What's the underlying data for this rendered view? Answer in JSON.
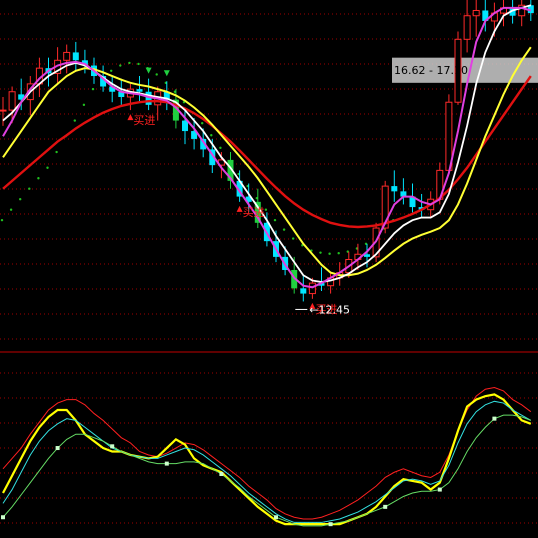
{
  "chart_data": [
    {
      "type": "candlestick",
      "panel": "price",
      "ylim": [
        11.6,
        18.2
      ],
      "colors": {
        "up": "#ff2a2a",
        "down": "#00e5ff",
        "down_big": "#20d040",
        "ma_white": "#ffffff",
        "ma_magenta": "#e040e0",
        "ma_yellow": "#ffff33",
        "ma_red": "#e01010",
        "dots": "#20c020",
        "signal": "#ff2020",
        "arrow": "#20d040",
        "band": "#cccccc"
      },
      "candles": [
        [
          0,
          16.1,
          16.35,
          15.8,
          16.1
        ],
        [
          1,
          16.1,
          16.55,
          15.85,
          16.45
        ],
        [
          2,
          16.4,
          16.7,
          16.1,
          16.3
        ],
        [
          3,
          16.3,
          16.75,
          16.0,
          16.6
        ],
        [
          4,
          16.6,
          17.1,
          16.35,
          16.9
        ],
        [
          5,
          16.9,
          17.1,
          16.55,
          16.8
        ],
        [
          6,
          16.8,
          17.3,
          16.6,
          17.05
        ],
        [
          7,
          17.05,
          17.35,
          16.8,
          17.2
        ],
        [
          8,
          17.2,
          17.4,
          16.85,
          17.05
        ],
        [
          9,
          17.05,
          17.25,
          16.8,
          16.95
        ],
        [
          10,
          16.95,
          17.1,
          16.6,
          16.75
        ],
        [
          11,
          16.75,
          16.95,
          16.45,
          16.55
        ],
        [
          12,
          16.55,
          16.75,
          16.25,
          16.45
        ],
        [
          13,
          16.45,
          16.7,
          16.2,
          16.35
        ],
        [
          14,
          16.35,
          16.6,
          16.1,
          16.5
        ],
        [
          15,
          16.5,
          16.75,
          16.25,
          16.45
        ],
        [
          16,
          16.45,
          16.7,
          16.1,
          16.2
        ],
        [
          17,
          16.2,
          16.55,
          15.9,
          16.45
        ],
        [
          18,
          16.45,
          16.65,
          16.1,
          16.3
        ],
        [
          19,
          16.3,
          16.5,
          15.75,
          15.9
        ],
        [
          20,
          15.9,
          16.1,
          15.45,
          15.7
        ],
        [
          21,
          15.7,
          15.95,
          15.35,
          15.55
        ],
        [
          22,
          15.55,
          15.75,
          15.2,
          15.35
        ],
        [
          23,
          15.35,
          15.55,
          14.9,
          15.05
        ],
        [
          24,
          15.05,
          15.3,
          14.8,
          15.15
        ],
        [
          25,
          15.15,
          15.3,
          14.6,
          14.75
        ],
        [
          26,
          14.75,
          14.95,
          14.35,
          14.45
        ],
        [
          27,
          14.45,
          14.7,
          14.15,
          14.35
        ],
        [
          28,
          14.35,
          14.6,
          13.85,
          13.95
        ],
        [
          29,
          13.95,
          14.15,
          13.5,
          13.6
        ],
        [
          30,
          13.6,
          13.8,
          13.2,
          13.3
        ],
        [
          31,
          13.3,
          13.5,
          12.95,
          13.05
        ],
        [
          32,
          13.05,
          13.3,
          12.6,
          12.7
        ],
        [
          33,
          12.7,
          12.95,
          12.45,
          12.6
        ],
        [
          34,
          12.6,
          12.9,
          12.5,
          12.8
        ],
        [
          35,
          12.8,
          13.1,
          12.65,
          12.75
        ],
        [
          36,
          12.75,
          13.0,
          12.6,
          12.9
        ],
        [
          37,
          12.9,
          13.2,
          12.75,
          13.0
        ],
        [
          38,
          13.0,
          13.4,
          12.9,
          13.25
        ],
        [
          39,
          13.25,
          13.55,
          13.05,
          13.35
        ],
        [
          40,
          13.35,
          13.55,
          13.1,
          13.3
        ],
        [
          41,
          13.3,
          13.95,
          13.2,
          13.85
        ],
        [
          42,
          13.85,
          14.75,
          13.75,
          14.65
        ],
        [
          43,
          14.65,
          14.95,
          14.35,
          14.55
        ],
        [
          44,
          14.55,
          14.8,
          14.3,
          14.45
        ],
        [
          45,
          14.45,
          14.7,
          14.15,
          14.25
        ],
        [
          46,
          14.25,
          14.5,
          14.05,
          14.2
        ],
        [
          47,
          14.2,
          14.55,
          14.05,
          14.4
        ],
        [
          48,
          14.4,
          15.1,
          14.3,
          14.95
        ],
        [
          49,
          14.95,
          16.4,
          14.9,
          16.25
        ],
        [
          50,
          16.25,
          17.6,
          16.2,
          17.45
        ],
        [
          51,
          17.45,
          18.2,
          17.2,
          17.9
        ],
        [
          52,
          17.9,
          18.2,
          17.5,
          18.0
        ],
        [
          53,
          18.0,
          18.2,
          17.6,
          17.8
        ],
        [
          54,
          17.8,
          18.15,
          17.5,
          17.95
        ],
        [
          55,
          17.95,
          18.2,
          17.7,
          18.05
        ],
        [
          56,
          18.05,
          18.2,
          17.75,
          17.9
        ],
        [
          57,
          17.9,
          18.2,
          17.7,
          18.1
        ],
        [
          58,
          18.1,
          18.2,
          17.8,
          17.95
        ]
      ],
      "ma_white": [
        15.9,
        16.05,
        16.25,
        16.45,
        16.6,
        16.75,
        16.85,
        16.95,
        17.0,
        16.95,
        16.85,
        16.72,
        16.6,
        16.5,
        16.45,
        16.42,
        16.38,
        16.35,
        16.32,
        16.25,
        16.1,
        15.9,
        15.7,
        15.45,
        15.2,
        15.0,
        14.75,
        14.5,
        14.25,
        14.0,
        13.7,
        13.45,
        13.2,
        12.95,
        12.85,
        12.82,
        12.85,
        12.9,
        12.98,
        13.1,
        13.2,
        13.35,
        13.55,
        13.75,
        13.9,
        14.0,
        14.05,
        14.05,
        14.15,
        14.5,
        15.1,
        15.8,
        16.6,
        17.2,
        17.6,
        17.9,
        18.0,
        18.05,
        18.1
      ],
      "ma_magenta": [
        15.6,
        15.9,
        16.25,
        16.5,
        16.7,
        16.85,
        16.95,
        17.0,
        17.02,
        16.98,
        16.85,
        16.7,
        16.55,
        16.45,
        16.42,
        16.4,
        16.35,
        16.32,
        16.28,
        16.15,
        15.95,
        15.75,
        15.5,
        15.25,
        15.0,
        14.8,
        14.55,
        14.3,
        14.05,
        13.75,
        13.45,
        13.15,
        12.9,
        12.75,
        12.72,
        12.8,
        12.9,
        13.0,
        13.12,
        13.25,
        13.4,
        13.6,
        13.95,
        14.3,
        14.45,
        14.45,
        14.35,
        14.3,
        14.4,
        14.9,
        15.7,
        16.6,
        17.4,
        17.8,
        17.95,
        18.05,
        18.05,
        18.05,
        18.0
      ],
      "ma_yellow": [
        15.2,
        15.45,
        15.7,
        15.95,
        16.2,
        16.45,
        16.6,
        16.75,
        16.85,
        16.9,
        16.88,
        16.82,
        16.75,
        16.68,
        16.62,
        16.58,
        16.55,
        16.5,
        16.45,
        16.38,
        16.28,
        16.15,
        16.0,
        15.82,
        15.62,
        15.42,
        15.22,
        15.02,
        14.8,
        14.55,
        14.3,
        14.05,
        13.8,
        13.55,
        13.35,
        13.15,
        13.0,
        12.95,
        12.95,
        12.98,
        13.05,
        13.15,
        13.28,
        13.42,
        13.55,
        13.65,
        13.72,
        13.78,
        13.85,
        14.0,
        14.3,
        14.7,
        15.15,
        15.6,
        16.0,
        16.4,
        16.75,
        17.05,
        17.3
      ],
      "ma_red": [
        14.6,
        14.75,
        14.9,
        15.05,
        15.2,
        15.35,
        15.5,
        15.62,
        15.75,
        15.86,
        15.96,
        16.05,
        16.12,
        16.18,
        16.22,
        16.25,
        16.27,
        16.27,
        16.25,
        16.2,
        16.13,
        16.04,
        15.93,
        15.8,
        15.65,
        15.5,
        15.33,
        15.15,
        14.97,
        14.79,
        14.62,
        14.46,
        14.32,
        14.2,
        14.1,
        14.02,
        13.95,
        13.91,
        13.88,
        13.87,
        13.88,
        13.9,
        13.94,
        13.99,
        14.05,
        14.12,
        14.2,
        14.3,
        14.42,
        14.58,
        14.78,
        15.0,
        15.25,
        15.5,
        15.75,
        16.0,
        16.25,
        16.5,
        16.75
      ],
      "dots": [
        14.0,
        14.2,
        14.4,
        14.6,
        14.8,
        15.0,
        15.3,
        15.6,
        15.9,
        16.2,
        16.5,
        16.7,
        16.85,
        16.95,
        17.0,
        16.98,
        16.9,
        16.78,
        16.62,
        16.45,
        16.25,
        16.05,
        15.85,
        15.62,
        15.38,
        15.12,
        14.88,
        14.65,
        14.42,
        14.2,
        14.0,
        13.82,
        13.65,
        13.52,
        13.42,
        13.38,
        13.36,
        13.37,
        13.4,
        13.46,
        13.55,
        13.68,
        13.84,
        14.0
      ],
      "dots_start": 0,
      "buy_signals": [
        {
          "x": 14,
          "label": "买进"
        },
        {
          "x": 26,
          "label": "买进"
        },
        {
          "x": 34,
          "label": "买进"
        }
      ],
      "sell_markers": [
        16,
        18
      ],
      "low_marker": {
        "x": 33,
        "value": 12.45,
        "label": "12.45"
      },
      "band": {
        "label": "16.62 - 17.10",
        "low": 16.62,
        "high": 17.1
      }
    },
    {
      "type": "line",
      "panel": "oscillator",
      "ylim": [
        0,
        100
      ],
      "series": [
        {
          "color": "#ff2020",
          "values": [
            40,
            46,
            52,
            60,
            67,
            74,
            78,
            80,
            80,
            77,
            72,
            68,
            63,
            58,
            55,
            50,
            48,
            47,
            49,
            52,
            55,
            54,
            51,
            47,
            43,
            39,
            35,
            30,
            26,
            22,
            17,
            14,
            12,
            11,
            11,
            12,
            14,
            16,
            19,
            22,
            26,
            30,
            35,
            38,
            40,
            38,
            36,
            35,
            38,
            48,
            62,
            74,
            82,
            86,
            87,
            85,
            80,
            77,
            73
          ]
        },
        {
          "color": "#ffff00",
          "values": [
            26,
            36,
            46,
            56,
            64,
            70,
            74,
            74,
            68,
            60,
            56,
            52,
            50,
            50,
            48,
            47,
            46,
            47,
            52,
            57,
            54,
            46,
            42,
            40,
            38,
            33,
            28,
            23,
            18,
            14,
            10,
            8,
            8,
            8,
            8,
            8,
            8,
            8,
            10,
            12,
            14,
            18,
            24,
            30,
            34,
            33,
            32,
            28,
            32,
            46,
            62,
            76,
            80,
            82,
            83,
            80,
            74,
            68,
            66
          ]
        },
        {
          "color": "#33e0e0",
          "values": [
            20,
            28,
            38,
            48,
            56,
            62,
            66,
            69,
            68,
            64,
            60,
            56,
            52,
            50,
            48,
            47,
            46,
            46,
            48,
            50,
            52,
            51,
            48,
            44,
            40,
            36,
            31,
            26,
            22,
            18,
            14,
            11,
            9,
            9,
            9,
            9,
            10,
            11,
            13,
            15,
            18,
            21,
            25,
            29,
            33,
            34,
            33,
            31,
            33,
            42,
            55,
            66,
            73,
            77,
            79,
            78,
            74,
            71,
            68
          ]
        },
        {
          "color": "#66dd66",
          "values": [
            12,
            18,
            25,
            32,
            39,
            46,
            52,
            57,
            60,
            60,
            58,
            56,
            53,
            50,
            48,
            46,
            44,
            43,
            43,
            43,
            44,
            44,
            43,
            40,
            37,
            33,
            29,
            24,
            20,
            16,
            12,
            10,
            8,
            7,
            7,
            7,
            8,
            9,
            10,
            12,
            14,
            16,
            18,
            21,
            24,
            26,
            27,
            27,
            28,
            32,
            40,
            50,
            58,
            64,
            69,
            71,
            71,
            70,
            68
          ]
        }
      ],
      "markers_series": 3,
      "markers_every": 6
    }
  ]
}
